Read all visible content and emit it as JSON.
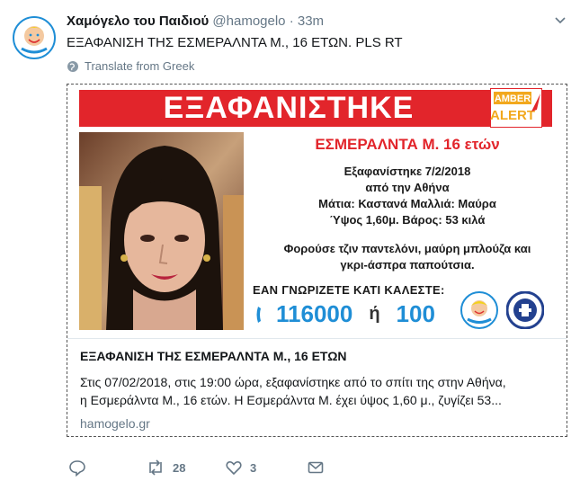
{
  "tweet": {
    "author_name": "Χαμόγελο του Παιδιού",
    "handle": "@hamogelo",
    "separator": "·",
    "time": "33m",
    "text": "ΕΞΑΦΑΝΙΣΗ ΤΗΣ ΕΣΜΕΡΑΛΝΤΑ Μ., 16 ΕΤΩΝ. PLS RT",
    "translate_label": "Translate from Greek"
  },
  "poster": {
    "banner_text": "ΕΞΑΦΑΝΙΣΤΗΚΕ",
    "amber_top": "AMBER",
    "amber_bottom": "ALERT",
    "name_age": "ΕΣΜΕΡΑΛΝΤΑ Μ. 16 ετών",
    "line1": "Εξαφανίστηκε 7/2/2018",
    "line2": "από την Αθήνα",
    "line3": "Μάτια: Καστανά Μαλλιά: Μαύρα",
    "line4": "Ύψος 1,60μ. Βάρος: 53 κιλά",
    "clothes1": "Φορούσε τζιν παντελόνι, μαύρη μπλούζα και",
    "clothes2": "γκρι-άσπρα παπούτσια.",
    "contact_label": "ΕΑΝ ΓΝΩΡΙΖΕΤΕ ΚΑΤΙ ΚΑΛΕΣΤΕ:",
    "phone_main": "116000",
    "phone_or": "ή",
    "phone_alt": "100"
  },
  "card": {
    "title": "ΕΞΑΦΑΝΙΣΗ ΤΗΣ ΕΣΜΕΡΑΛΝΤΑ Μ., 16 ΕΤΩΝ",
    "desc_line1": "Στις 07/02/2018, στις 19:00 ώρα, εξαφανίστηκε από το σπίτι της στην Αθήνα,",
    "desc_line2": "η Εσμεράλντα Μ., 16 ετών. Η Εσμεράλντα Μ. έχει ύψος 1,60 μ., ζυγίζει 53...",
    "domain": "hamogelo.gr"
  },
  "actions": {
    "retweet_count": "28",
    "like_count": "3"
  },
  "colors": {
    "twitter_blue": "#1f8ed6",
    "alert_red": "#e2252b",
    "muted": "#657786"
  }
}
